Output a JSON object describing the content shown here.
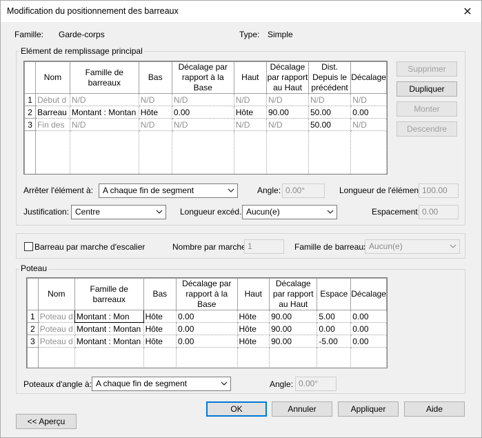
{
  "window": {
    "title": "Modification du positionnement des barreaux",
    "close_glyph": "✕"
  },
  "info": {
    "famille_label": "Famille:",
    "famille_value": "Garde-corps",
    "type_label": "Type:",
    "type_value": "Simple"
  },
  "main_group": {
    "title": "Elément de remplissage principal",
    "headers": [
      "Nom",
      "Famille de barreaux",
      "Bas",
      "Décalage par rapport à la Base",
      "Haut",
      "Décalage par rapport au Haut",
      "Dist. Depuis le précédent",
      "Décalage"
    ],
    "rows": [
      {
        "num": "1",
        "cells": [
          "Début d",
          "N/D",
          "N/D",
          "N/D",
          "N/D",
          "N/D",
          "N/D",
          "N/D"
        ]
      },
      {
        "num": "2",
        "cells": [
          "Barreau",
          "Montant : Montan",
          "Hôte",
          "0.00",
          "Hôte",
          "90.00",
          "50.00",
          "0.00"
        ]
      },
      {
        "num": "3",
        "cells": [
          "Fin des",
          "N/D",
          "N/D",
          "N/D",
          "N/D",
          "N/D",
          "50.00",
          "N/D"
        ]
      }
    ],
    "buttons": {
      "supprimer": "Supprimer",
      "dupliquer": "Dupliquer",
      "monter": "Monter",
      "descendre": "Descendre"
    },
    "arreter_label": "Arrêter l'élément à:",
    "arreter_value": "A chaque fin de segment",
    "angle_label": "Angle:",
    "angle_value": "0.00°",
    "longueur_element_label": "Longueur de l'élément:",
    "longueur_element_value": "100.00",
    "justification_label": "Justification:",
    "justification_value": "Centre",
    "longueur_exced_label": "Longueur excéd.:",
    "longueur_exced_value": "Aucun(e)",
    "espacement_label": "Espacement:",
    "espacement_value": "0.00"
  },
  "stair": {
    "checkbox_label": "Barreau par marche d'escalier",
    "checked": false,
    "nombre_label": "Nombre par marche:",
    "nombre_value": "1",
    "famille_label": "Famille de barreaux:",
    "famille_value": "Aucun(e)"
  },
  "poteau_group": {
    "title": "Poteau",
    "headers": [
      "Nom",
      "Famille de barreaux",
      "Bas",
      "Décalage par rapport à la Base",
      "Haut",
      "Décalage par rapport au Haut",
      "Espace",
      "Décalage"
    ],
    "rows": [
      {
        "num": "1",
        "cells": [
          "Poteau d",
          "Montant : Mon",
          "Hôte",
          "0.00",
          "Hôte",
          "90.00",
          "5.00",
          "0.00"
        ]
      },
      {
        "num": "2",
        "cells": [
          "Poteau d",
          "Montant : Montan",
          "Hôte",
          "0.00",
          "Hôte",
          "90.00",
          "0.00",
          "0.00"
        ]
      },
      {
        "num": "3",
        "cells": [
          "Poteau d",
          "Montant : Montan",
          "Hôte",
          "0.00",
          "Hôte",
          "90.00",
          "-5.00",
          "0.00"
        ]
      }
    ],
    "angle_posts_label": "Poteaux d'angle à:",
    "angle_posts_value": "A chaque fin de segment",
    "angle_label": "Angle:",
    "angle_value": "0.00°"
  },
  "footer": {
    "ok": "OK",
    "annuler": "Annuler",
    "appliquer": "Appliquer",
    "aide": "Aide",
    "apercu": "<< Aperçu"
  },
  "colors": {
    "accent": "#0078d7",
    "disabled_text": "#a0a0a0",
    "background": "#f0f0f0"
  }
}
